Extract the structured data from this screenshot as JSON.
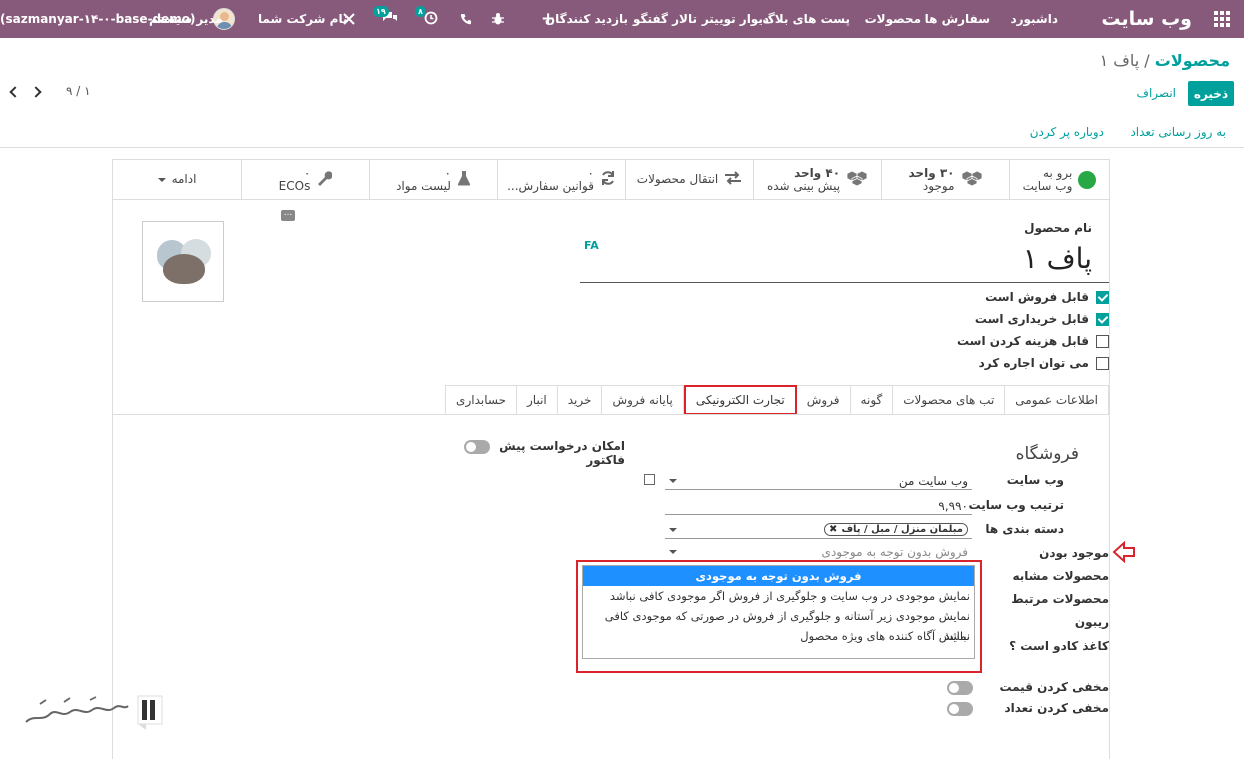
{
  "topbar": {
    "brand": "وب سایت",
    "menu": [
      "داشبورد",
      "سفارش ها",
      "محصولات",
      "پست های بلاگ",
      "دیوار توییتر",
      "تالار گفتگو",
      "بازدید کنندگان"
    ],
    "plus": "+",
    "activity_badge": "۸",
    "messages_badge": "۱۹",
    "company": "نام شرکت شما",
    "user": "مدیر سیستم",
    "db": "(sazmanyar-۱۴-۰-base-demo)"
  },
  "breadcrumb": {
    "parent": "محصولات",
    "separator": "/",
    "current": "پاف ۱"
  },
  "buttons": {
    "save": "ذخیره",
    "discard": "انصراف"
  },
  "pager": "۹ / ۱",
  "actions": {
    "update_qty": "به روز رسانی تعداد",
    "replenish": "دوباره پر کردن"
  },
  "smart_buttons": {
    "website": {
      "line1": "برو به",
      "line2": "وب سایت"
    },
    "onhand": {
      "value": "۳۰ واحد",
      "label": "موجود"
    },
    "forecast": {
      "value": "۴۰ واحد",
      "label": "پیش بینی شده"
    },
    "moves": {
      "label": "انتقال محصولات"
    },
    "rules": {
      "value": "۰",
      "label": "قوانین سفارش..."
    },
    "bom": {
      "value": "۰",
      "label": "لیست مواد"
    },
    "ecos": {
      "value": "۰",
      "label": "ECOs"
    },
    "more": {
      "label": "ادامه"
    }
  },
  "product": {
    "name_label": "نام محصول",
    "name": "پاف ۱",
    "lang": "FA",
    "checkboxes": [
      {
        "label": "قابل فروش است",
        "checked": true
      },
      {
        "label": "قابل خریداری است",
        "checked": true
      },
      {
        "label": "قابل هزینه کردن است",
        "checked": false
      },
      {
        "label": "می توان اجاره کرد",
        "checked": false
      }
    ]
  },
  "tabs": [
    "اطلاعات عمومی",
    "تب های محصولات",
    "گونه",
    "فروش",
    "تجارت الکترونیکی",
    "پایانه فروش",
    "خرید",
    "انبار",
    "حسابداری"
  ],
  "active_tab": "تجارت الکترونیکی",
  "ecommerce": {
    "section_title": "فروشگاه",
    "website_label": "وب سایت",
    "website_value": "وب سایت من",
    "sequence_label": "ترتیب وب سایت",
    "sequence_value": "۹,۹۹۰",
    "categories_label": "دسته بندی ها",
    "category_tag": "مبلمان منزل / مبل / پاف",
    "availability_label": "موجود بودن",
    "availability_value": "فروش بدون توجه به موجودی",
    "alternative_label": "محصولات مشابه",
    "accessory_label": "محصولات مرتبط",
    "ribbon_label": "ریبون",
    "gift_label": "کاغذ کادو است ؟",
    "hide_price_label": "مخفی کردن قیمت",
    "hide_qty_label": "مخفی کردن تعداد",
    "quote_label_1": "امکان درخواست پیش",
    "quote_label_2": "فاکتور"
  },
  "dropdown": {
    "options": [
      "فروش بدون توجه به موجودی",
      "نمایش موجودی در وب سایت و جلوگیری از فروش اگر موجودی کافی نباشد",
      "نمایش موجودی زیر آستانه و جلوگیری از فروش در صورتی که موجودی کافی نباشد",
      "نمایش آگاه کننده های ویژه محصول"
    ],
    "selected": 0
  },
  "colors": {
    "topbar": "#875a7b",
    "accent": "#00a09d",
    "highlight": "#d9242b",
    "selected_option": "#1e90ff"
  }
}
